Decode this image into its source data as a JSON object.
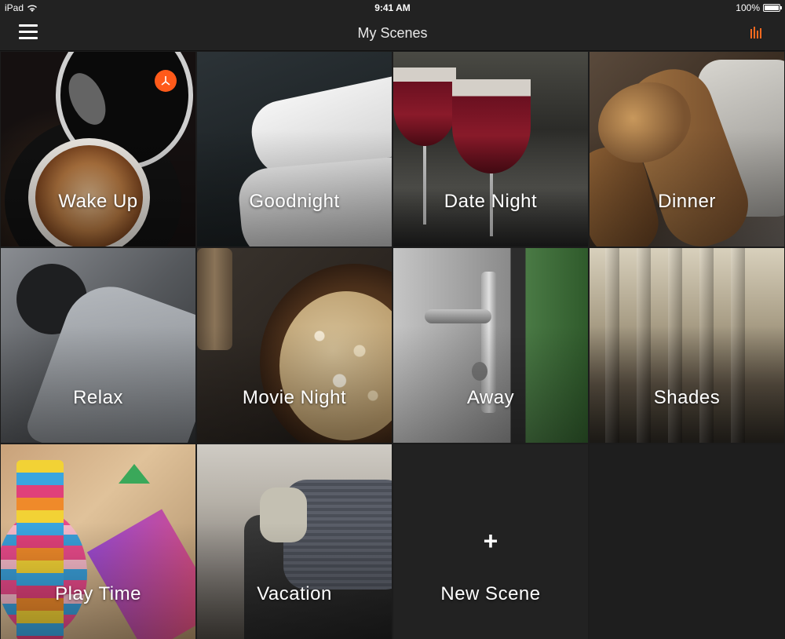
{
  "status_bar": {
    "device": "iPad",
    "time": "9:41 AM",
    "battery": "100%"
  },
  "nav": {
    "title": "My Scenes"
  },
  "colors": {
    "accent": "#ff6a1f",
    "background": "#1c1c1c"
  },
  "scenes": [
    {
      "label": "Wake Up",
      "has_timer": true
    },
    {
      "label": "Goodnight"
    },
    {
      "label": "Date Night"
    },
    {
      "label": "Dinner"
    },
    {
      "label": "Relax"
    },
    {
      "label": "Movie Night"
    },
    {
      "label": "Away"
    },
    {
      "label": "Shades"
    },
    {
      "label": "Play Time"
    },
    {
      "label": "Vacation"
    },
    {
      "label": "New Scene",
      "icon": "plus-icon"
    }
  ]
}
